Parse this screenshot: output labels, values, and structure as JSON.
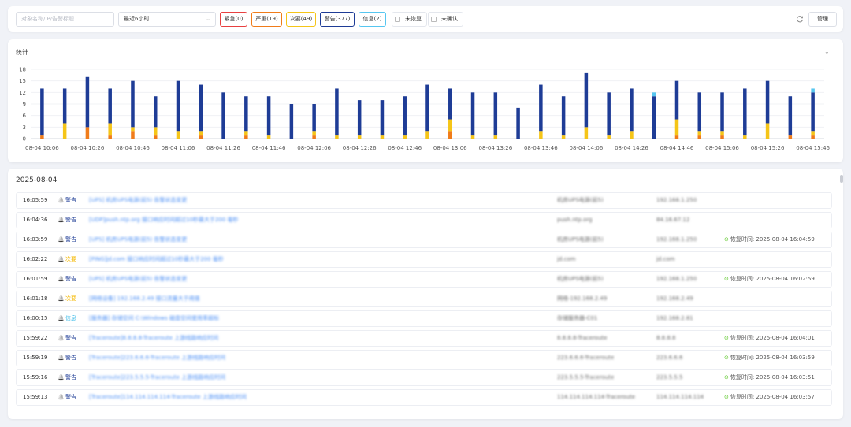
{
  "filter": {
    "search_placeholder": "对象名称/IP/告警标题",
    "time_range": "最近6小时",
    "severity_tags": [
      {
        "label": "紧急(0)",
        "color": "#e84040"
      },
      {
        "label": "严重(19)",
        "color": "#f07c1a"
      },
      {
        "label": "次要(49)",
        "color": "#f5c518"
      },
      {
        "label": "警告(377)",
        "color": "#1e3c96"
      },
      {
        "label": "信息(2)",
        "color": "#56c6f0"
      }
    ],
    "checkbox_unrecovered": "未恢复",
    "checkbox_unconfirmed": "未确认",
    "manage_label": "管理"
  },
  "stats": {
    "title": "统计"
  },
  "chart_data": {
    "type": "bar",
    "stacked": true,
    "ylim": [
      0,
      18
    ],
    "yticks": [
      0,
      3,
      6,
      9,
      12,
      15,
      18
    ],
    "x_tick_labels": [
      "08-04 10:06",
      "08-04 10:26",
      "08-04 10:46",
      "08-04 11:06",
      "08-04 11:26",
      "08-04 11:46",
      "08-04 12:06",
      "08-04 12:26",
      "08-04 12:46",
      "08-04 13:06",
      "08-04 13:26",
      "08-04 13:46",
      "08-04 14:06",
      "08-04 14:26",
      "08-04 14:46",
      "08-04 15:06",
      "08-04 15:26",
      "08-04 15:46"
    ],
    "categories": [
      "10:06",
      "10:16",
      "10:26",
      "10:36",
      "10:46",
      "10:56",
      "11:06",
      "11:16",
      "11:26",
      "11:36",
      "11:46",
      "11:56",
      "12:06",
      "12:16",
      "12:26",
      "12:36",
      "12:46",
      "12:56",
      "13:06",
      "13:16",
      "13:26",
      "13:36",
      "13:46",
      "13:56",
      "14:06",
      "14:16",
      "14:26",
      "14:36",
      "14:46",
      "14:56",
      "15:06",
      "15:16",
      "15:26",
      "15:36",
      "15:46"
    ],
    "series": [
      {
        "name": "严重",
        "color": "#f07c1a",
        "values": [
          1,
          0,
          3,
          1,
          2,
          1,
          0,
          1,
          0,
          1,
          0,
          0,
          1,
          0,
          0,
          0,
          0,
          0,
          2,
          0,
          0,
          0,
          0,
          0,
          0,
          0,
          0,
          0,
          1,
          1,
          1,
          0,
          0,
          1,
          1
        ]
      },
      {
        "name": "次要",
        "color": "#f5c518",
        "values": [
          0,
          4,
          0,
          3,
          1,
          2,
          2,
          1,
          0,
          1,
          1,
          0,
          1,
          1,
          1,
          1,
          1,
          2,
          3,
          1,
          1,
          0,
          2,
          1,
          3,
          1,
          2,
          0,
          4,
          1,
          1,
          1,
          4,
          0,
          1
        ]
      },
      {
        "name": "警告",
        "color": "#1e3c96",
        "values": [
          12,
          9,
          13,
          9,
          12,
          8,
          13,
          12,
          12,
          9,
          10,
          9,
          7,
          12,
          9,
          9,
          10,
          12,
          8,
          11,
          11,
          8,
          12,
          10,
          14,
          11,
          11,
          11,
          10,
          10,
          10,
          12,
          11,
          10,
          10
        ]
      },
      {
        "name": "信息",
        "color": "#56c6f0",
        "values": [
          0,
          0,
          0,
          0,
          0,
          0,
          0,
          0,
          0,
          0,
          0,
          0,
          0,
          0,
          0,
          0,
          0,
          0,
          0,
          0,
          0,
          0,
          0,
          0,
          0,
          0,
          0,
          1,
          0,
          0,
          0,
          0,
          0,
          0,
          1
        ]
      }
    ]
  },
  "events": {
    "date": "2025-08-04",
    "recovery_prefix": "恢复时间:",
    "rows": [
      {
        "time": "16:05:59",
        "level": "警告",
        "level_color": "#1e3c96",
        "title": "[UPS] 机房UPS电源(前5) 告警状态变更",
        "object": "机房UPS电源(前5)",
        "ip": "192.168.1.250",
        "recovery": ""
      },
      {
        "time": "16:04:36",
        "level": "警告",
        "level_color": "#1e3c96",
        "title": "[UDP]push.ntp.org 接口响应时间超过10秒最大于200 毫秒",
        "object": "push.ntp.org",
        "ip": "84.16.67.12",
        "recovery": ""
      },
      {
        "time": "16:03:59",
        "level": "警告",
        "level_color": "#1e3c96",
        "title": "[UPS] 机房UPS电源(前5) 告警状态变更",
        "object": "机房UPS电源(前5)",
        "ip": "192.168.1.250",
        "recovery": "2025-08-04 16:04:59"
      },
      {
        "time": "16:02:22",
        "level": "次要",
        "level_color": "#f5b800",
        "title": "[PING]jd.com 接口响应时间超过10秒最大于200 毫秒",
        "object": "jd.com",
        "ip": "jd.com",
        "recovery": ""
      },
      {
        "time": "16:01:59",
        "level": "警告",
        "level_color": "#1e3c96",
        "title": "[UPS] 机房UPS电源(前5) 告警状态变更",
        "object": "机房UPS电源(前5)",
        "ip": "192.168.1.250",
        "recovery": "2025-08-04 16:02:59"
      },
      {
        "time": "16:01:18",
        "level": "次要",
        "level_color": "#f5b800",
        "title": "[网络设备] 192.168.2.49 接口流量大于阈值",
        "object": "网络-192.168.2.49",
        "ip": "192.168.2.49",
        "recovery": ""
      },
      {
        "time": "16:00:15",
        "level": "信息",
        "level_color": "#3bbbe8",
        "title": "[服务器] 存储空间 C:\\Windows 磁盘空间使用率超标",
        "object": "存储服务器-C01",
        "ip": "192.168.2.81",
        "recovery": ""
      },
      {
        "time": "15:59:22",
        "level": "警告",
        "level_color": "#1e3c96",
        "title": "[Traceroute]8.8.8.8-Traceroute 上游线路响应时间",
        "object": "8.8.8.8-Traceroute",
        "ip": "8.8.8.8",
        "recovery": "2025-08-04 16:04:01"
      },
      {
        "time": "15:59:19",
        "level": "警告",
        "level_color": "#1e3c96",
        "title": "[Traceroute]223.6.6.6-Traceroute 上游线路响应时间",
        "object": "223.6.6.6-Traceroute",
        "ip": "223.6.6.6",
        "recovery": "2025-08-04 16:03:59"
      },
      {
        "time": "15:59:16",
        "level": "警告",
        "level_color": "#1e3c96",
        "title": "[Traceroute]223.5.5.5-Traceroute 上游线路响应时间",
        "object": "223.5.5.5-Traceroute",
        "ip": "223.5.5.5",
        "recovery": "2025-08-04 16:03:51"
      },
      {
        "time": "15:59:13",
        "level": "警告",
        "level_color": "#1e3c96",
        "title": "[Traceroute]114.114.114.114-Traceroute 上游线路响应时间",
        "object": "114.114.114.114-Traceroute",
        "ip": "114.114.114.114",
        "recovery": "2025-08-04 16:03:57"
      }
    ]
  }
}
